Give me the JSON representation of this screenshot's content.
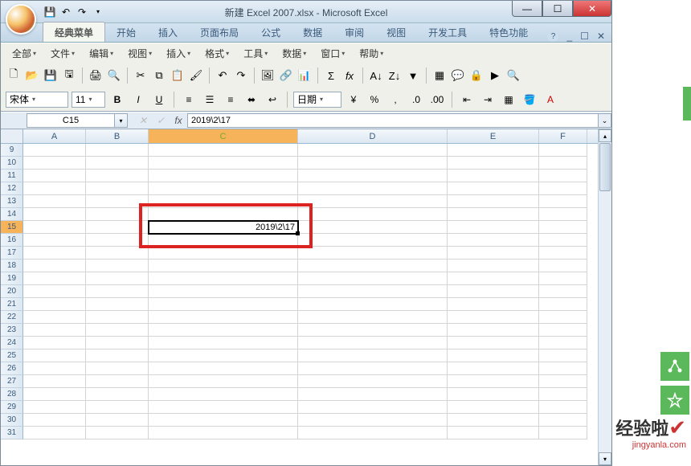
{
  "title": "新建 Excel 2007.xlsx - Microsoft Excel",
  "qat_icons": [
    "save-icon",
    "undo-icon",
    "redo-icon",
    "qat-dropdown-icon"
  ],
  "window_controls": {
    "minimize": "—",
    "maximize": "☐",
    "close": "✕"
  },
  "tabs": [
    "经典菜单",
    "开始",
    "插入",
    "页面布局",
    "公式",
    "数据",
    "审阅",
    "视图",
    "开发工具",
    "特色功能"
  ],
  "active_tab_index": 0,
  "tab_right": {
    "help": "?",
    "min": "_",
    "restore": "☐",
    "close": "✕"
  },
  "menubar": [
    "全部",
    "文件",
    "编辑",
    "视图",
    "插入",
    "格式",
    "工具",
    "数据",
    "窗口",
    "帮助"
  ],
  "format_row": {
    "font_name": "宋体",
    "font_size": "11",
    "buttons": [
      "B",
      "I",
      "U"
    ],
    "align": [
      "align-left-icon",
      "align-center-icon",
      "align-right-icon",
      "merge-icon",
      "wrap-icon"
    ],
    "number_format": "日期",
    "misc": [
      "currency-icon",
      "percent-icon",
      "comma-icon",
      "increase-decimal-icon",
      "decrease-decimal-icon",
      "indent-dec-icon",
      "indent-inc-icon",
      "borders-icon",
      "fill-color-icon",
      "font-color-icon"
    ]
  },
  "name_box": "C15",
  "formula": "2019\\2\\17",
  "columns": [
    "A",
    "B",
    "C",
    "D",
    "E",
    "F"
  ],
  "visible_rows": [
    9,
    10,
    11,
    12,
    13,
    14,
    15,
    16,
    17,
    18,
    19,
    20,
    21,
    22,
    23,
    24,
    25,
    26,
    27,
    28,
    29,
    30,
    31
  ],
  "selected_cell": {
    "col": "C",
    "row": 15,
    "value": "2019\\2\\17"
  },
  "watermark": {
    "big": "经验啦",
    "check": "✔",
    "url": "jingyanla.com"
  }
}
